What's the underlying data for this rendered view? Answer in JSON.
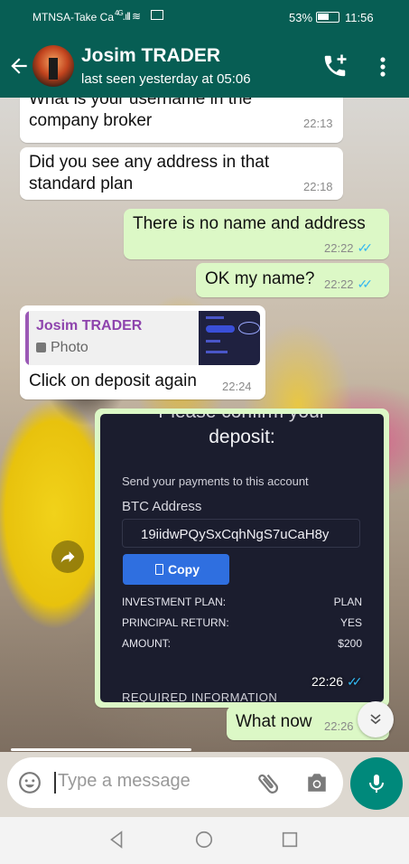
{
  "status_bar": {
    "carrier": "MTNSA-Take Ca",
    "network": "4G",
    "battery_percent": "53%",
    "time": "11:56"
  },
  "header": {
    "contact_name": "Josim TRADER",
    "last_seen": "last seen yesterday at 05:06"
  },
  "messages": [
    {
      "direction": "in",
      "text": "What is your username in the\ncompany broker",
      "time": "22:13"
    },
    {
      "direction": "in",
      "text": "Did you see any address in that\nstandard plan",
      "time": "22:18"
    },
    {
      "direction": "out",
      "text": "There is no name and address",
      "time": "22:22",
      "read": true
    },
    {
      "direction": "out",
      "text": "OK my name?",
      "time": "22:22",
      "read": true
    },
    {
      "direction": "in",
      "reply_to_name": "Josim TRADER",
      "reply_to_type": "Photo",
      "text": "Click on deposit again",
      "time": "22:24"
    },
    {
      "direction": "out",
      "type": "image",
      "time": "22:26",
      "read": true
    },
    {
      "direction": "out",
      "text": "What now",
      "time": "22:26"
    }
  ],
  "deposit_screenshot": {
    "title_top": "Please confirm your",
    "title": "deposit:",
    "instruction": "Send your payments to this account",
    "currency_label": "BTC Address",
    "address": "19iidwPQySxCqhNgS7uCaH8y",
    "copy_label": "Copy",
    "rows": [
      {
        "key": "INVESTMENT PLAN:",
        "value": "PLAN"
      },
      {
        "key": "PRINCIPAL RETURN:",
        "value": "YES"
      },
      {
        "key": "AMOUNT:",
        "value": "$200"
      }
    ],
    "footer": "REQUIRED INFORMATION"
  },
  "input": {
    "placeholder": "Type a message"
  },
  "colors": {
    "header": "#075e54",
    "outgoing_bubble": "#dcf8c6",
    "incoming_bubble": "#ffffff",
    "read_ticks": "#34b7f1",
    "mic_button": "#00897b",
    "copy_button": "#2f6fe0"
  },
  "icons": [
    "back-arrow-icon",
    "add-call-icon",
    "more-vert-icon",
    "emoji-icon",
    "attach-icon",
    "camera-icon",
    "mic-icon",
    "share-icon",
    "scroll-down-icon",
    "photo-icon",
    "nav-back-icon",
    "nav-home-icon",
    "nav-recents-icon"
  ]
}
